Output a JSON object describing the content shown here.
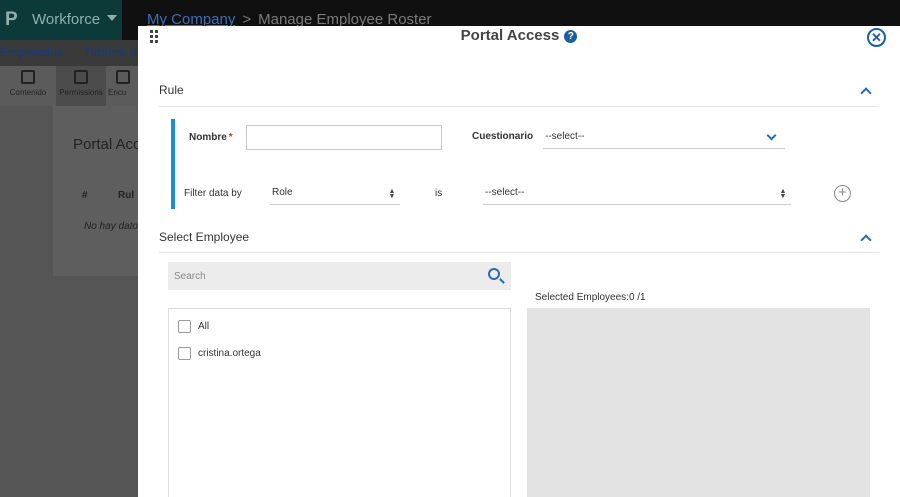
{
  "app": {
    "logo": "P",
    "name": "Workforce",
    "breadcrumb_link": "My Company",
    "breadcrumb_sep": ">",
    "breadcrumb_current": "Manage Employee Roster"
  },
  "nav": {
    "items": [
      "Empleados",
      "Tablero de"
    ]
  },
  "toolbar": {
    "items": [
      "Contenido",
      "Permissions",
      "Encu"
    ]
  },
  "background": {
    "title": "Portal Acc",
    "col_num": "#",
    "col_rule": "Rul",
    "no_data": "No hay dato"
  },
  "modal": {
    "title": "Portal Access",
    "help_glyph": "?",
    "close_glyph": "✕",
    "rule_section": {
      "heading": "Rule",
      "nombre_label": "Nombre",
      "required_mark": "*",
      "nombre_value": "",
      "cuestionario_label": "Cuestionario",
      "cuestionario_value": "--select--",
      "filter_label": "Filter data by",
      "filter_field": "Role",
      "operator": "is",
      "filter_value": "--select--",
      "add_glyph": "+"
    },
    "employee_section": {
      "heading": "Select Employee",
      "search_placeholder": "Search",
      "items": [
        "All",
        "cristina.ortega"
      ],
      "selected_label": "Selected Employees:0 /1"
    }
  },
  "colors": {
    "accent": "#1f8ae0",
    "link": "#2a6cb4",
    "required": "#c0392b"
  }
}
